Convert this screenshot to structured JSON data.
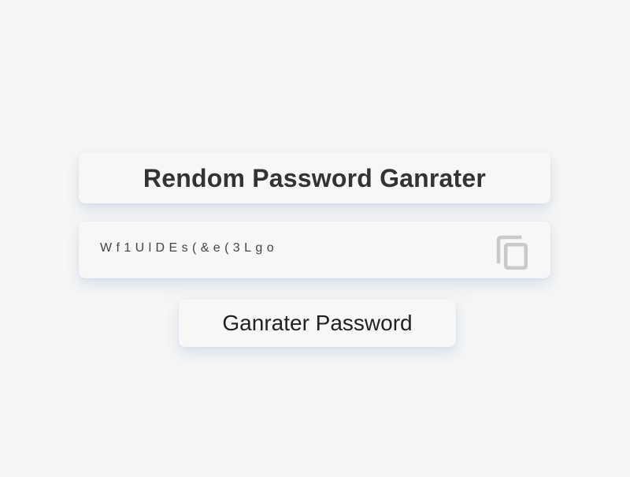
{
  "header": {
    "title": "Rendom Password Ganrater"
  },
  "password": {
    "value": "Wf1UlDEs(&e(3Lgo",
    "copy_icon": "copy-icon"
  },
  "actions": {
    "generate_label": "Ganrater Password"
  },
  "colors": {
    "background": "#f6f6f6",
    "card": "#f7f7f7",
    "title_text": "#333333",
    "icon": "#c9c9c9"
  }
}
